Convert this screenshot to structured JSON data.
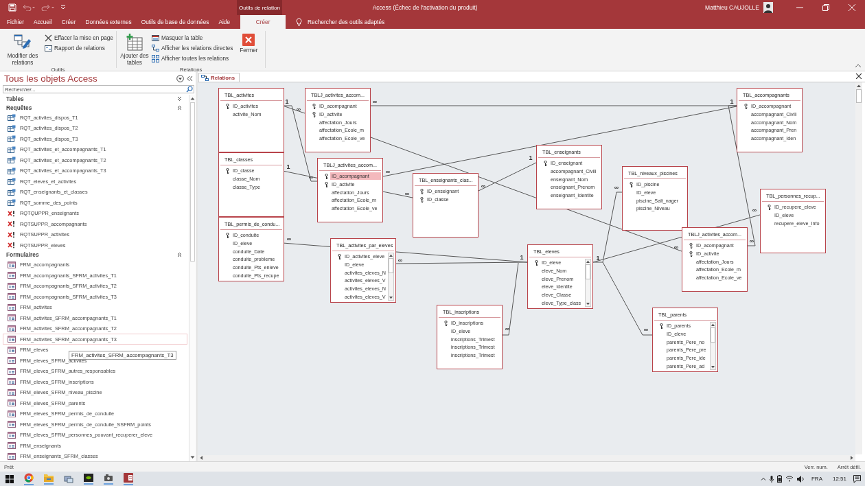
{
  "title_bar": {
    "context_label": "Outils de relation",
    "title": "Access (Échec de l'activation du produit)",
    "user": "Matthieu CAUJOLLE"
  },
  "ribbon_tabs": [
    {
      "label": "Fichier",
      "selected": false
    },
    {
      "label": "Accueil",
      "selected": false
    },
    {
      "label": "Créer",
      "selected": false
    },
    {
      "label": "Données externes",
      "selected": false
    },
    {
      "label": "Outils de base de données",
      "selected": false
    },
    {
      "label": "Aide",
      "selected": false
    },
    {
      "label": "Créer",
      "selected": true
    }
  ],
  "tell_me": "Rechercher des outils adaptés",
  "ribbon_groups": [
    {
      "label": "Outils",
      "buttons": [
        {
          "label": "Modifier des relations",
          "kind": "large"
        },
        {
          "label": "Effacer la mise en page",
          "kind": "small"
        },
        {
          "label": "Rapport de relations",
          "kind": "small"
        }
      ]
    },
    {
      "label": "Relations",
      "buttons": [
        {
          "label": "Ajouter des tables",
          "kind": "large"
        },
        {
          "label": "Masquer la table",
          "kind": "small"
        },
        {
          "label": "Afficher les relations directes",
          "kind": "small"
        },
        {
          "label": "Afficher toutes les relations",
          "kind": "small"
        },
        {
          "label": "Fermer",
          "kind": "large"
        }
      ]
    }
  ],
  "nav": {
    "title": "Tous les objets Access",
    "search_placeholder": "Rechercher...",
    "sections": [
      {
        "label": "Tables",
        "expanded": false
      },
      {
        "label": "Requêtes",
        "expanded": true,
        "items": [
          {
            "label": "RQT_activites_dispos_T1",
            "kind": "query",
            "selected": false
          },
          {
            "label": "RQT_activites_dispos_T2",
            "kind": "query",
            "selected": false
          },
          {
            "label": "RQT_activites_dispos_T3",
            "kind": "query",
            "selected": false
          },
          {
            "label": "RQT_activites_et_accompagnants_T1",
            "kind": "query",
            "selected": false
          },
          {
            "label": "RQT_activites_et_accompagnants_T2",
            "kind": "query",
            "selected": false
          },
          {
            "label": "RQT_activites_et_accompagnants_T3",
            "kind": "query",
            "selected": false
          },
          {
            "label": "RQT_eleves_et_activites",
            "kind": "query",
            "selected": false
          },
          {
            "label": "RQT_enseignants_et_classes",
            "kind": "query",
            "selected": false
          },
          {
            "label": "RQT_somme_des_points",
            "kind": "query",
            "selected": false
          },
          {
            "label": "RQTQUPPR_enseignants",
            "kind": "delete",
            "selected": false
          },
          {
            "label": "RQTSUPPR_accompagnants",
            "kind": "delete",
            "selected": false
          },
          {
            "label": "RQTSUPPR_activites",
            "kind": "delete",
            "selected": false
          },
          {
            "label": "RQTSUPPR_eleves",
            "kind": "delete",
            "selected": false
          }
        ]
      },
      {
        "label": "Formulaires",
        "expanded": true,
        "items": [
          {
            "label": "FRM_accompagnants",
            "kind": "form",
            "selected": false
          },
          {
            "label": "FRM_accompagnants_SFRM_activites_T1",
            "kind": "form",
            "selected": false
          },
          {
            "label": "FRM_accompagnants_SFRM_activites_T2",
            "kind": "form",
            "selected": false
          },
          {
            "label": "FRM_accompagnants_SFRM_activites_T3",
            "kind": "form",
            "selected": false
          },
          {
            "label": "FRM_activites",
            "kind": "form",
            "selected": false
          },
          {
            "label": "FRM_activites_SFRM_accompagnants_T1",
            "kind": "form",
            "selected": false
          },
          {
            "label": "FRM_activites_SFRM_accompagnants_T2",
            "kind": "form",
            "selected": false
          },
          {
            "label": "FRM_activites_SFRM_accompagnants_T3",
            "kind": "form",
            "selected": true
          },
          {
            "label": "FRM_eleves",
            "kind": "form",
            "selected": false
          },
          {
            "label": "FRM_eleves_SFRM_activites",
            "kind": "form",
            "selected": false
          },
          {
            "label": "FRM_eleves_SFRM_autres_responsables",
            "kind": "form",
            "selected": false
          },
          {
            "label": "FRM_eleves_SFRM_inscriptions",
            "kind": "form",
            "selected": false
          },
          {
            "label": "FRM_eleves_SFRM_niveau_piscine",
            "kind": "form",
            "selected": false
          },
          {
            "label": "FRM_eleves_SFRM_parents",
            "kind": "form",
            "selected": false
          },
          {
            "label": "FRM_eleves_SFRM_permis_de_conduite",
            "kind": "form",
            "selected": false
          },
          {
            "label": "FRM_eleves_SFRM_permis_de_conduite_SSFRM_points",
            "kind": "form",
            "selected": false
          },
          {
            "label": "FRM_eleves_SFRM_personnes_pouvant_recuperer_eleve",
            "kind": "form",
            "selected": false
          },
          {
            "label": "FRM_enseignants",
            "kind": "form",
            "selected": false
          },
          {
            "label": "FRM_enseignants_SFRM_classes",
            "kind": "form",
            "selected": false
          }
        ]
      }
    ],
    "tooltip": "FRM_activites_SFRM_accompagnants_T3"
  },
  "document_tab": "Relations",
  "tables": [
    {
      "title": "TBL_activites",
      "scrollable": false,
      "fields": [
        {
          "name": "ID_activites",
          "key": true,
          "selected": false
        },
        {
          "name": "activite_Nom",
          "key": false,
          "selected": false
        }
      ]
    },
    {
      "title": "TBLJ_activites_accom...",
      "scrollable": false,
      "fields": [
        {
          "name": "ID_acompagnant",
          "key": true,
          "selected": false
        },
        {
          "name": "ID_activite",
          "key": true,
          "selected": false
        },
        {
          "name": "affectation_Jours",
          "key": false,
          "selected": false
        },
        {
          "name": "affectation_Ecole_m",
          "key": false,
          "selected": false
        },
        {
          "name": "affectation_Ecole_ve",
          "key": false,
          "selected": false
        }
      ]
    },
    {
      "title": "TBL_classes",
      "scrollable": false,
      "fields": [
        {
          "name": "ID_classe",
          "key": true,
          "selected": false
        },
        {
          "name": "classe_Nom",
          "key": false,
          "selected": false
        },
        {
          "name": "classe_Type",
          "key": false,
          "selected": false
        }
      ]
    },
    {
      "title": "TBLJ_activites_accom...",
      "scrollable": false,
      "fields": [
        {
          "name": "ID_acompagnant",
          "key": true,
          "selected": true
        },
        {
          "name": "ID_activite",
          "key": true,
          "selected": false
        },
        {
          "name": "affectation_Jours",
          "key": false,
          "selected": false
        },
        {
          "name": "affectation_Ecole_m",
          "key": false,
          "selected": false
        },
        {
          "name": "affectation_Ecole_ve",
          "key": false,
          "selected": false
        }
      ]
    },
    {
      "title": "TBL_enseignants_clas...",
      "scrollable": false,
      "fields": [
        {
          "name": "ID_enseignant",
          "key": true,
          "selected": false
        },
        {
          "name": "ID_classe",
          "key": true,
          "selected": false
        }
      ]
    },
    {
      "title": "TBL_enseignants",
      "scrollable": false,
      "fields": [
        {
          "name": "ID_enseignant",
          "key": true,
          "selected": false
        },
        {
          "name": "accompagnant_Civili",
          "key": false,
          "selected": false
        },
        {
          "name": "enseignant_Nom",
          "key": false,
          "selected": false
        },
        {
          "name": "enseignant_Prenom",
          "key": false,
          "selected": false
        },
        {
          "name": "enseignant_Identite",
          "key": false,
          "selected": false
        }
      ]
    },
    {
      "title": "TBL_accompagnants",
      "scrollable": false,
      "fields": [
        {
          "name": "ID_accompagnant",
          "key": true,
          "selected": false
        },
        {
          "name": "accompagnant_Civili",
          "key": false,
          "selected": false
        },
        {
          "name": "accompagnant_Nom",
          "key": false,
          "selected": false
        },
        {
          "name": "accompagnant_Pren",
          "key": false,
          "selected": false
        },
        {
          "name": "accompagnant_Iden",
          "key": false,
          "selected": false
        }
      ]
    },
    {
      "title": "TBL_niveaux_piscines",
      "scrollable": false,
      "fields": [
        {
          "name": "ID_piscine",
          "key": true,
          "selected": false
        },
        {
          "name": "ID_eleve",
          "key": false,
          "selected": false
        },
        {
          "name": "piscine_Salt_nager",
          "key": false,
          "selected": false
        },
        {
          "name": "piscine_Niveau",
          "key": false,
          "selected": false
        }
      ]
    },
    {
      "title": "TBL_personnes_recup...",
      "scrollable": false,
      "fields": [
        {
          "name": "ID_recupere_eleve",
          "key": true,
          "selected": false
        },
        {
          "name": "ID_eleve",
          "key": false,
          "selected": false
        },
        {
          "name": "recupere_eleve_Info",
          "key": false,
          "selected": false
        }
      ]
    },
    {
      "title": "TBL_permis_de_condu...",
      "scrollable": false,
      "fields": [
        {
          "name": "ID_conduite",
          "key": true,
          "selected": false
        },
        {
          "name": "ID_eleve",
          "key": false,
          "selected": false
        },
        {
          "name": "conduite_Date",
          "key": false,
          "selected": false
        },
        {
          "name": "conduite_probleme",
          "key": false,
          "selected": false
        },
        {
          "name": "conduite_Pts_enleve",
          "key": false,
          "selected": false
        },
        {
          "name": "conduite_Pts_recupe",
          "key": false,
          "selected": false
        }
      ]
    },
    {
      "title": "TBL_activites_par_eleves",
      "scrollable": true,
      "fields": [
        {
          "name": "ID_activites_eleve",
          "key": true,
          "selected": false
        },
        {
          "name": "ID_eleve",
          "key": false,
          "selected": false
        },
        {
          "name": "activites_eleves_N",
          "key": false,
          "selected": false
        },
        {
          "name": "activites_eleves_V",
          "key": false,
          "selected": false
        },
        {
          "name": "activites_eleves_N",
          "key": false,
          "selected": false
        },
        {
          "name": "activites_eleves_V",
          "key": false,
          "selected": false
        }
      ]
    },
    {
      "title": "TBL_eleves",
      "scrollable": true,
      "fields": [
        {
          "name": "ID_eleve",
          "key": true,
          "selected": false
        },
        {
          "name": "eleve_Nom",
          "key": false,
          "selected": false
        },
        {
          "name": "eleve_Prenom",
          "key": false,
          "selected": false
        },
        {
          "name": "eleve_Identite",
          "key": false,
          "selected": false
        },
        {
          "name": "eleve_Classe",
          "key": false,
          "selected": false
        },
        {
          "name": "eleve_Type_class",
          "key": false,
          "selected": false
        }
      ]
    },
    {
      "title": "TBLJ_activites_accom...",
      "scrollable": false,
      "fields": [
        {
          "name": "ID_acompagnant",
          "key": true,
          "selected": false
        },
        {
          "name": "ID_activite",
          "key": true,
          "selected": false
        },
        {
          "name": "affectation_Jours",
          "key": false,
          "selected": false
        },
        {
          "name": "affectation_Ecole_m",
          "key": false,
          "selected": false
        },
        {
          "name": "affectation_Ecole_ve",
          "key": false,
          "selected": false
        }
      ]
    },
    {
      "title": "TBL_inscriptions",
      "scrollable": false,
      "fields": [
        {
          "name": "ID_inscriptions",
          "key": true,
          "selected": false
        },
        {
          "name": "ID_eleve",
          "key": false,
          "selected": false
        },
        {
          "name": "inscriptions_Trimest",
          "key": false,
          "selected": false
        },
        {
          "name": "inscriptions_Trimest",
          "key": false,
          "selected": false
        },
        {
          "name": "inscriptions_Trimest",
          "key": false,
          "selected": false
        }
      ]
    },
    {
      "title": "TBL_parents",
      "scrollable": true,
      "fields": [
        {
          "name": "ID_parents",
          "key": true,
          "selected": false
        },
        {
          "name": "ID_eleve",
          "key": false,
          "selected": false
        },
        {
          "name": "parents_Pere_no",
          "key": false,
          "selected": false
        },
        {
          "name": "parents_Pere_pre",
          "key": false,
          "selected": false
        },
        {
          "name": "parents_Pere_ide",
          "key": false,
          "selected": false
        },
        {
          "name": "parents_Pere_ad",
          "key": false,
          "selected": false
        }
      ]
    }
  ],
  "relationships": [
    {
      "labels": [
        "1",
        "∞"
      ]
    },
    {
      "labels": [
        "∞"
      ]
    },
    {
      "labels": [
        "1",
        "∞"
      ]
    },
    {
      "labels": [
        "∞",
        "1"
      ]
    },
    {
      "labels": [
        "∞"
      ]
    },
    {
      "labels": [
        "∞"
      ]
    },
    {
      "labels": [
        "∞",
        "1"
      ]
    },
    {
      "labels": [
        "∞"
      ]
    },
    {
      "labels": [
        "1",
        "∞"
      ]
    },
    {
      "labels": [
        "∞"
      ]
    },
    {
      "labels": [
        "∞"
      ]
    },
    {
      "labels": [
        "∞",
        "1"
      ]
    },
    {
      "labels": [
        "∞"
      ]
    },
    {
      "labels": [
        "∞"
      ]
    }
  ],
  "status_bar": {
    "text": "Prêt",
    "indicators": [
      "Verr. num.",
      "Arrêt défil."
    ]
  },
  "taskbar": {
    "language": "FRA",
    "time": "12:51"
  }
}
